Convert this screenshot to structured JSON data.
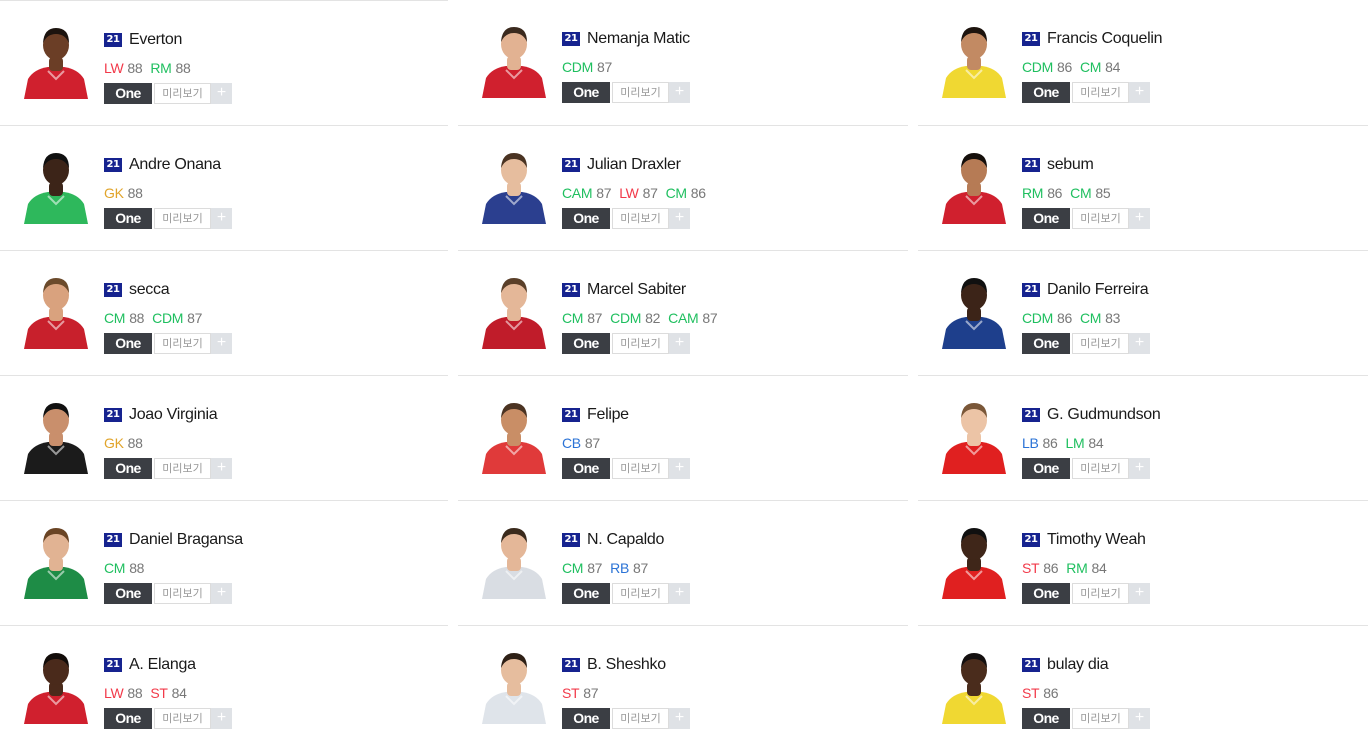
{
  "labels": {
    "one_button": "One",
    "preview_button": "미리보기",
    "plus_button": "+"
  },
  "columns": [
    {
      "players": [
        {
          "season": "21",
          "name": "Everton",
          "positions": [
            {
              "pos": "LW",
              "ovr": "88",
              "group": "fw"
            },
            {
              "pos": "RM",
              "ovr": "88",
              "group": "mf"
            }
          ],
          "shirt": "#d0202e",
          "skin": "#6b3e26",
          "hair": "#1c130e"
        },
        {
          "season": "21",
          "name": "Andre Onana",
          "positions": [
            {
              "pos": "GK",
              "ovr": "88",
              "group": "gk"
            }
          ],
          "shirt": "#2eb85c",
          "skin": "#3c2418",
          "hair": "#101010"
        },
        {
          "season": "21",
          "name": "secca",
          "positions": [
            {
              "pos": "CM",
              "ovr": "88",
              "group": "mf"
            },
            {
              "pos": "CDM",
              "ovr": "87",
              "group": "mf"
            }
          ],
          "shirt": "#c8202c",
          "skin": "#d9a27e",
          "hair": "#6b4a2b"
        },
        {
          "season": "21",
          "name": "Joao Virginia",
          "positions": [
            {
              "pos": "GK",
              "ovr": "88",
              "group": "gk"
            }
          ],
          "shirt": "#1b1b1b",
          "skin": "#c98f6c",
          "hair": "#111111"
        },
        {
          "season": "21",
          "name": "Daniel Bragansa",
          "positions": [
            {
              "pos": "CM",
              "ovr": "88",
              "group": "mf"
            }
          ],
          "shirt": "#1e8c46",
          "skin": "#e1b393",
          "hair": "#6a4424"
        },
        {
          "season": "21",
          "name": "A. Elanga",
          "positions": [
            {
              "pos": "LW",
              "ovr": "88",
              "group": "fw"
            },
            {
              "pos": "ST",
              "ovr": "84",
              "group": "fw"
            }
          ],
          "shirt": "#d0202e",
          "skin": "#4a2a1b",
          "hair": "#120c09"
        }
      ]
    },
    {
      "players": [
        {
          "season": "21",
          "name": "Nemanja Matic",
          "positions": [
            {
              "pos": "CDM",
              "ovr": "87",
              "group": "mf"
            }
          ],
          "shirt": "#d0202e",
          "skin": "#e2b292",
          "hair": "#3b2a1e"
        },
        {
          "season": "21",
          "name": "Julian Draxler",
          "positions": [
            {
              "pos": "CAM",
              "ovr": "87",
              "group": "mf"
            },
            {
              "pos": "LW",
              "ovr": "87",
              "group": "fw"
            },
            {
              "pos": "CM",
              "ovr": "86",
              "group": "mf"
            }
          ],
          "shirt": "#2b3f8f",
          "skin": "#e6bd9e",
          "hair": "#4a3322"
        },
        {
          "season": "21",
          "name": "Marcel Sabiter",
          "positions": [
            {
              "pos": "CM",
              "ovr": "87",
              "group": "mf"
            },
            {
              "pos": "CDM",
              "ovr": "82",
              "group": "mf"
            },
            {
              "pos": "CAM",
              "ovr": "87",
              "group": "mf"
            }
          ],
          "shirt": "#c01c2a",
          "skin": "#e4b798",
          "hair": "#5a3f29"
        },
        {
          "season": "21",
          "name": "Felipe",
          "positions": [
            {
              "pos": "CB",
              "ovr": "87",
              "group": "df"
            }
          ],
          "shirt": "#e03a3a",
          "skin": "#c98e66",
          "hair": "#4b3322"
        },
        {
          "season": "21",
          "name": "N. Capaldo",
          "positions": [
            {
              "pos": "CM",
              "ovr": "87",
              "group": "mf"
            },
            {
              "pos": "RB",
              "ovr": "87",
              "group": "df"
            }
          ],
          "shirt": "#d9dde3",
          "skin": "#e4b798",
          "hair": "#3a2a1c"
        },
        {
          "season": "21",
          "name": "B. Sheshko",
          "positions": [
            {
              "pos": "ST",
              "ovr": "87",
              "group": "fw"
            }
          ],
          "shirt": "#dfe4ea",
          "skin": "#e6bd9e",
          "hair": "#2e2016"
        }
      ]
    },
    {
      "players": [
        {
          "season": "21",
          "name": "Francis Coquelin",
          "positions": [
            {
              "pos": "CDM",
              "ovr": "86",
              "group": "mf"
            },
            {
              "pos": "CM",
              "ovr": "84",
              "group": "mf"
            }
          ],
          "shirt": "#f0d832",
          "skin": "#c28a63",
          "hair": "#1d140e"
        },
        {
          "season": "21",
          "name": "sebum",
          "positions": [
            {
              "pos": "RM",
              "ovr": "86",
              "group": "mf"
            },
            {
              "pos": "CM",
              "ovr": "85",
              "group": "mf"
            }
          ],
          "shirt": "#d0202e",
          "skin": "#b67b55",
          "hair": "#150f0b"
        },
        {
          "season": "21",
          "name": "Danilo Ferreira",
          "positions": [
            {
              "pos": "CDM",
              "ovr": "86",
              "group": "mf"
            },
            {
              "pos": "CM",
              "ovr": "83",
              "group": "mf"
            }
          ],
          "shirt": "#1e3f8c",
          "skin": "#3c2418",
          "hair": "#101010"
        },
        {
          "season": "21",
          "name": "G. Gudmundson",
          "positions": [
            {
              "pos": "LB",
              "ovr": "86",
              "group": "df"
            },
            {
              "pos": "LM",
              "ovr": "84",
              "group": "mf"
            }
          ],
          "shirt": "#e02020",
          "skin": "#ecc4a6",
          "hair": "#7a5738"
        },
        {
          "season": "21",
          "name": "Timothy Weah",
          "positions": [
            {
              "pos": "ST",
              "ovr": "86",
              "group": "fw"
            },
            {
              "pos": "RM",
              "ovr": "84",
              "group": "mf"
            }
          ],
          "shirt": "#e02020",
          "skin": "#3f2619",
          "hair": "#101010"
        },
        {
          "season": "21",
          "name": "bulay dia",
          "positions": [
            {
              "pos": "ST",
              "ovr": "86",
              "group": "fw"
            }
          ],
          "shirt": "#f0d832",
          "skin": "#4a2c1c",
          "hair": "#141010"
        }
      ]
    }
  ]
}
